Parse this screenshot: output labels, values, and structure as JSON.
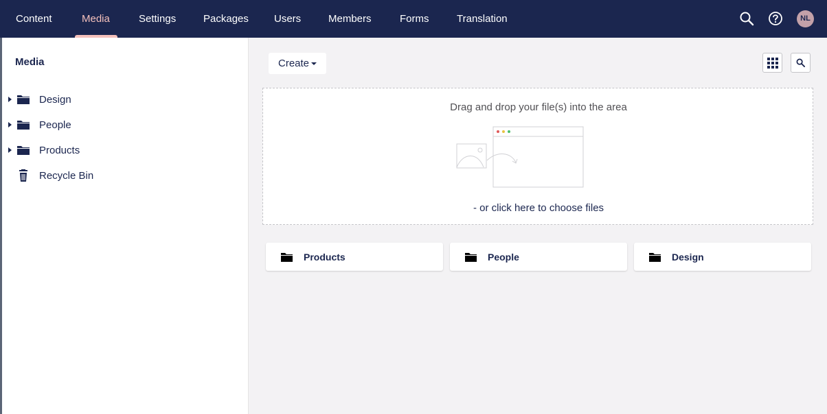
{
  "topnav": {
    "items": [
      {
        "label": "Content"
      },
      {
        "label": "Media",
        "active": true
      },
      {
        "label": "Settings"
      },
      {
        "label": "Packages"
      },
      {
        "label": "Users"
      },
      {
        "label": "Members"
      },
      {
        "label": "Forms"
      },
      {
        "label": "Translation"
      }
    ],
    "icons": [
      "search-icon",
      "help-icon"
    ],
    "avatar_initials": "NL",
    "active_color": "#f5c1bc",
    "background": "#1b264f"
  },
  "sidebar": {
    "title": "Media",
    "items": [
      {
        "label": "Design",
        "icon": "folder-icon",
        "expandable": true
      },
      {
        "label": "People",
        "icon": "folder-icon",
        "expandable": true
      },
      {
        "label": "Products",
        "icon": "folder-icon",
        "expandable": true
      },
      {
        "label": "Recycle Bin",
        "icon": "trash-icon",
        "expandable": false
      }
    ]
  },
  "toolbar": {
    "create_label": "Create",
    "icons": [
      "grid-view-icon",
      "search-icon"
    ]
  },
  "dropzone": {
    "instruction": "Drag and drop your file(s) into the area",
    "choose_link": "- or click here to choose files"
  },
  "folders": [
    {
      "label": "Products",
      "icon": "folder-icon"
    },
    {
      "label": "People",
      "icon": "folder-icon"
    },
    {
      "label": "Design",
      "icon": "folder-icon"
    }
  ]
}
